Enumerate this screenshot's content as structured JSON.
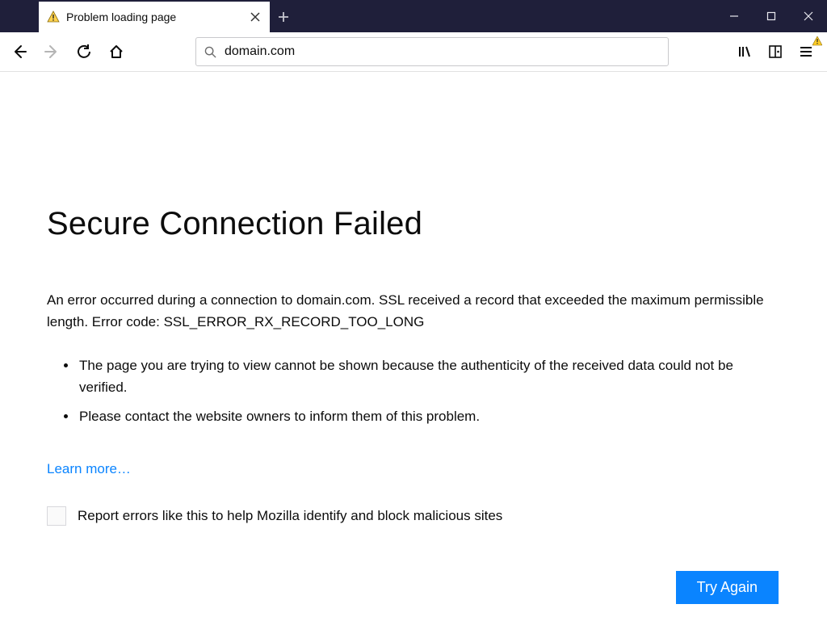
{
  "tab": {
    "title": "Problem loading page"
  },
  "urlbar": {
    "value": "domain.com"
  },
  "error": {
    "heading": "Secure Connection Failed",
    "description": "An error occurred during a connection to domain.com. SSL received a record that exceeded the maximum permissible length. Error code: SSL_ERROR_RX_RECORD_TOO_LONG",
    "bullets": [
      "The page you are trying to view cannot be shown because the authenticity of the received data could not be verified.",
      "Please contact the website owners to inform them of this problem."
    ],
    "learn_more": "Learn more…",
    "report_label": "Report errors like this to help Mozilla identify and block malicious sites",
    "try_again": "Try Again"
  }
}
